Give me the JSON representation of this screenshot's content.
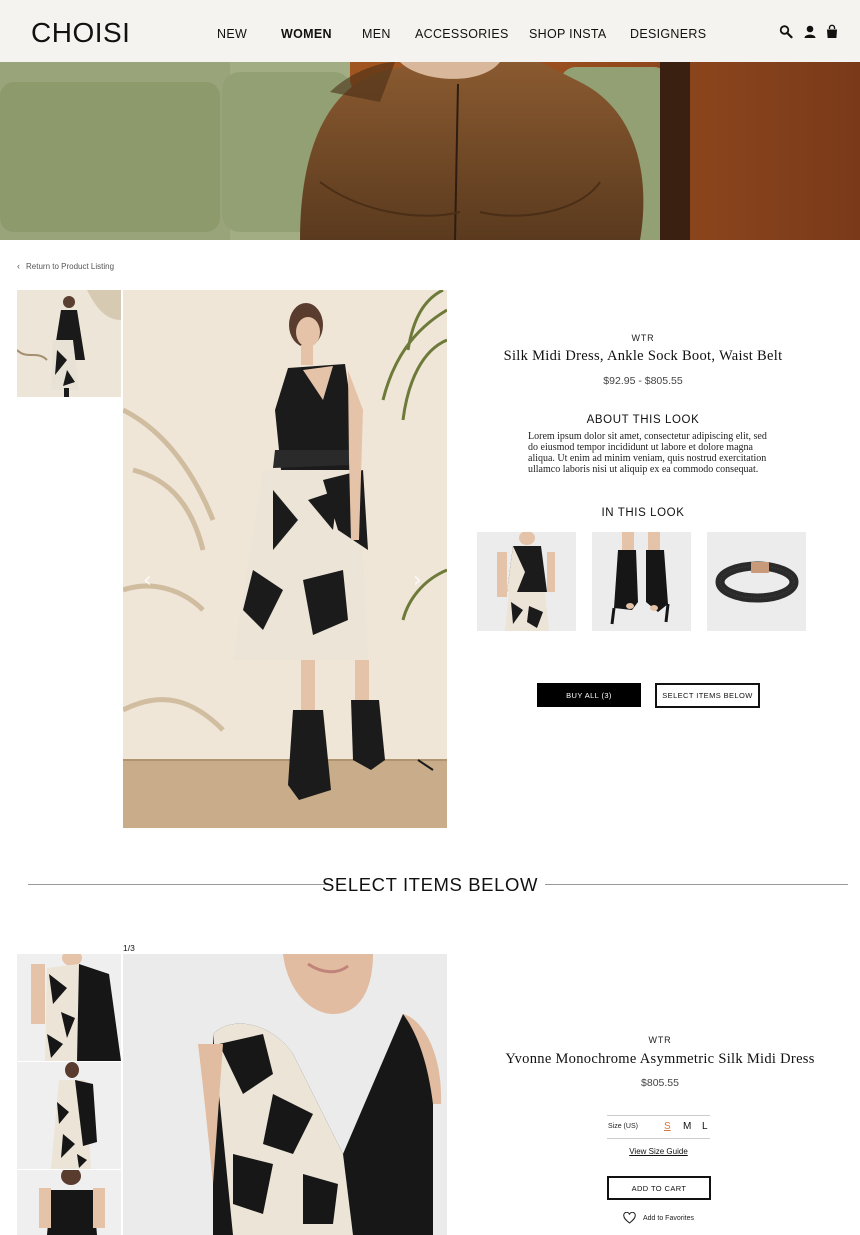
{
  "header": {
    "logo": "CHOISI",
    "nav": [
      "NEW",
      "WOMEN",
      "MEN",
      "ACCESSORIES",
      "SHOP INSTA",
      "DESIGNERS"
    ],
    "active_nav": "WOMEN",
    "icons": [
      "search-icon",
      "account-icon",
      "bag-icon"
    ]
  },
  "back_link": "Return to Product Listing",
  "look": {
    "brand": "WTR",
    "title": "Silk Midi Dress, Ankle Sock Boot, Waist Belt",
    "price": "$92.95 - $805.55",
    "about_heading": "ABOUT THIS LOOK",
    "about_text": "Lorem ipsum dolor sit amet, consectetur adipiscing elit, sed do eiusmod tempor incididunt ut labore et dolore magna aliqua. Ut enim ad minim veniam, quis nostrud exercitation ullamco laboris nisi ut aliquip ex ea commodo consequat.",
    "in_this_look_heading": "IN THIS LOOK",
    "items": [
      "silk midi dress",
      "ankle sock boot",
      "waist belt"
    ],
    "buy_all_label": "BUY ALL (3)",
    "select_items_label": "SELECT ITEMS BELOW"
  },
  "section_title": "SELECT ITEMS BELOW",
  "product": {
    "counter": "1/3",
    "brand": "WTR",
    "title": "Yvonne Monochrome Asymmetric Silk Midi Dress",
    "price": "$805.55",
    "size_label": "Size (US)",
    "sizes": [
      "S",
      "M",
      "L"
    ],
    "selected_size": "S",
    "size_guide": "View Size Guide",
    "add_to_cart": "ADD TO CART",
    "add_to_favorites": "Add to Favorites"
  },
  "colors": {
    "header_bg": "#f4f3ef",
    "accent": "#d57a3a",
    "dark": "#000000"
  }
}
